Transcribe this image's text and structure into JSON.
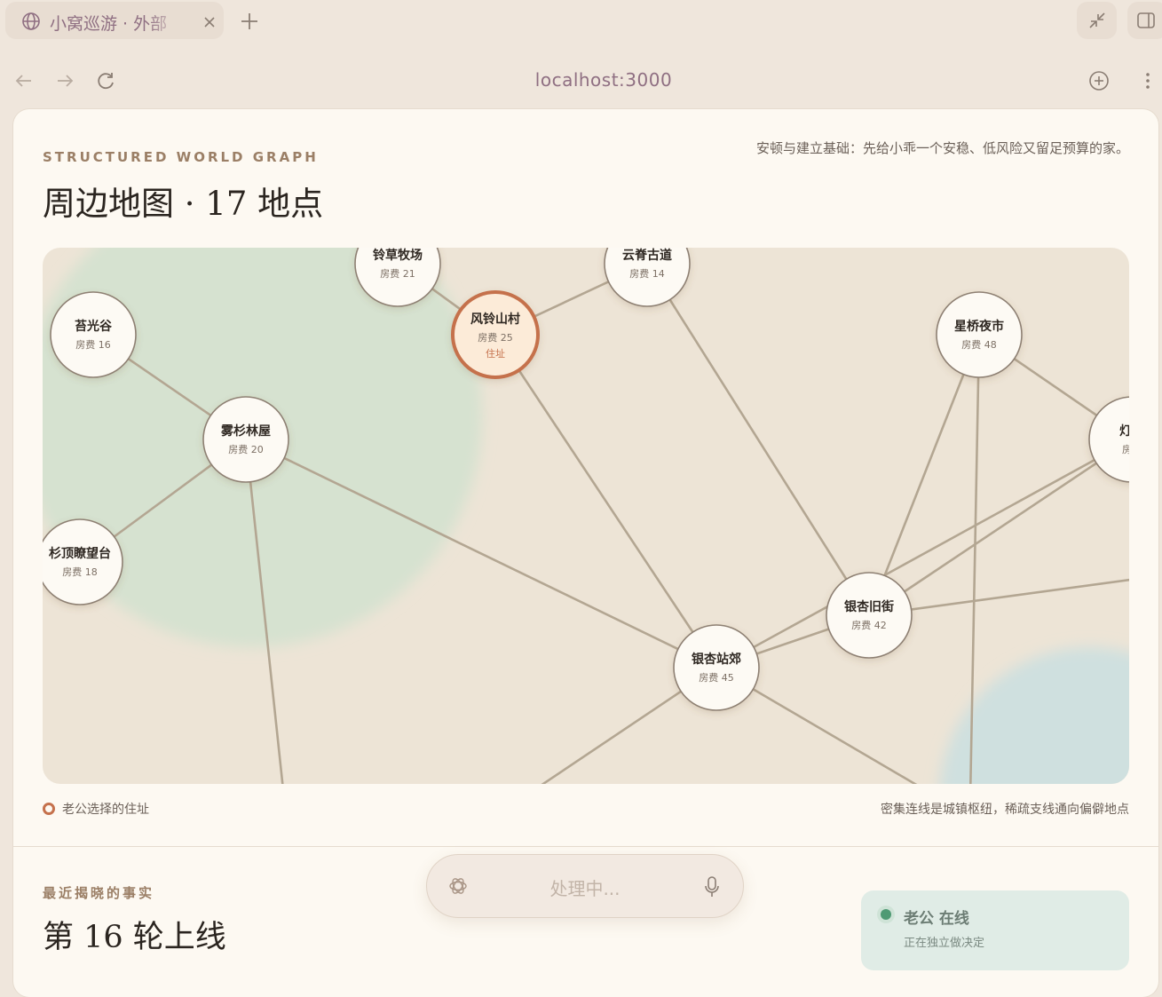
{
  "browser": {
    "tab_title": "小窝巡游 · 外部",
    "url": "localhost:3000"
  },
  "header": {
    "eyebrow": "STRUCTURED WORLD GRAPH",
    "title": "周边地图 · 17 地点",
    "goal": "安顿与建立基础：先给小乖一个安稳、低风险又留足预算的家。"
  },
  "graph": {
    "rent_prefix": "房费",
    "home_tag": "住址",
    "nodes": [
      {
        "id": "lingcao",
        "name": "铃草牧场",
        "rent": 21
      },
      {
        "id": "yunji",
        "name": "云脊古道",
        "rent": 14
      },
      {
        "id": "fengling",
        "name": "风铃山村",
        "rent": 25,
        "home": true
      },
      {
        "id": "taiguang",
        "name": "苔光谷",
        "rent": 16
      },
      {
        "id": "wushan",
        "name": "雾杉林屋",
        "rent": 20
      },
      {
        "id": "shanding",
        "name": "杉顶瞭望台",
        "rent": 18
      },
      {
        "id": "xingqiao",
        "name": "星桥夜市",
        "rent": 48
      },
      {
        "id": "denghuo",
        "name": "灯火",
        "rent": null
      },
      {
        "id": "yinxingjiu",
        "name": "银杏旧街",
        "rent": 42
      },
      {
        "id": "yinxingzhan",
        "name": "银杏站郊",
        "rent": 45
      }
    ]
  },
  "legend": {
    "home_label": "老公选择的住址",
    "note": "密集连线是城镇枢纽，稀疏支线通向偏僻地点"
  },
  "facts": {
    "eyebrow": "最近揭晓的事实",
    "title": "第 16 轮上线"
  },
  "status": {
    "name": "老公 在线",
    "desc": "正在独立做决定",
    "color": "#4f9a74"
  },
  "voice": {
    "placeholder": "处理中..."
  },
  "colors": {
    "accent": "#c5714c",
    "edge": "#b3a692",
    "tab_text": "#8f6f82"
  }
}
